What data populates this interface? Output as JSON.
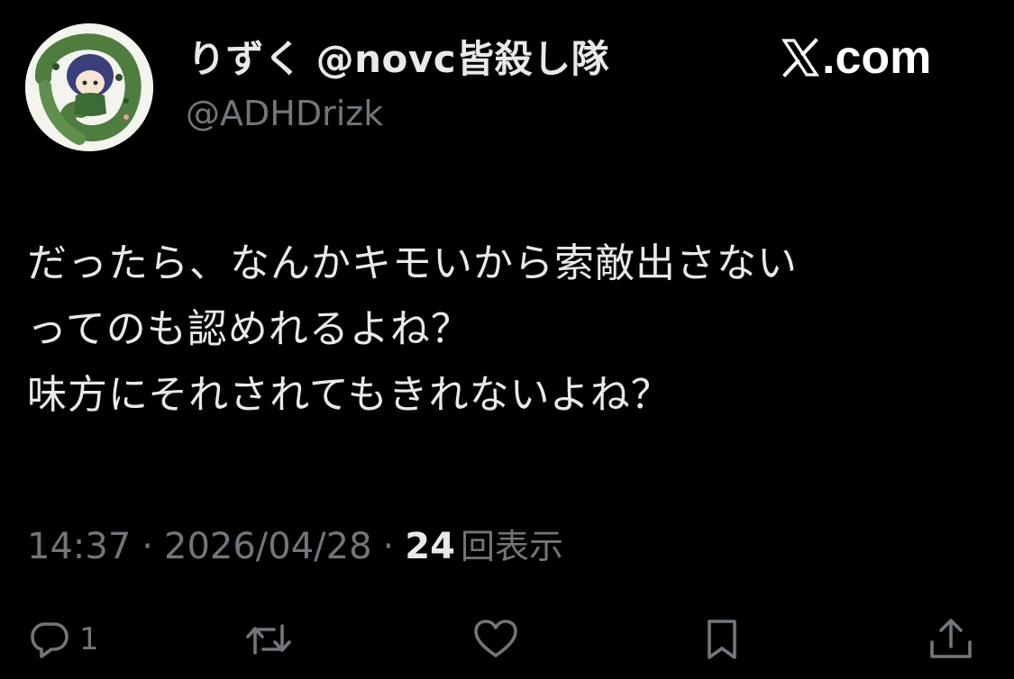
{
  "author": {
    "display_name": "りずく @novc皆殺し隊",
    "handle": "@ADHDrizk",
    "avatar_icon": "avatar-image"
  },
  "brand": {
    "logo_icon": "x-logo-icon",
    "text": ".com"
  },
  "tweet": {
    "lines": [
      "だったら、なんかキモいから索敵出さない",
      "ってのも認めれるよね？",
      "味方にそれされてもきれないよね？"
    ]
  },
  "meta": {
    "time": "14:37",
    "separator": "·",
    "date": "2026/04/28",
    "views_count": "24",
    "views_label": "回表示"
  },
  "actions": {
    "reply": {
      "icon": "reply-icon",
      "count": "1"
    },
    "retweet": {
      "icon": "retweet-icon"
    },
    "like": {
      "icon": "heart-icon"
    },
    "bookmark": {
      "icon": "bookmark-icon"
    },
    "share": {
      "icon": "share-icon"
    }
  },
  "colors": {
    "background": "#000000",
    "primary_text": "#e7e9ea",
    "secondary_text": "#71767b"
  }
}
